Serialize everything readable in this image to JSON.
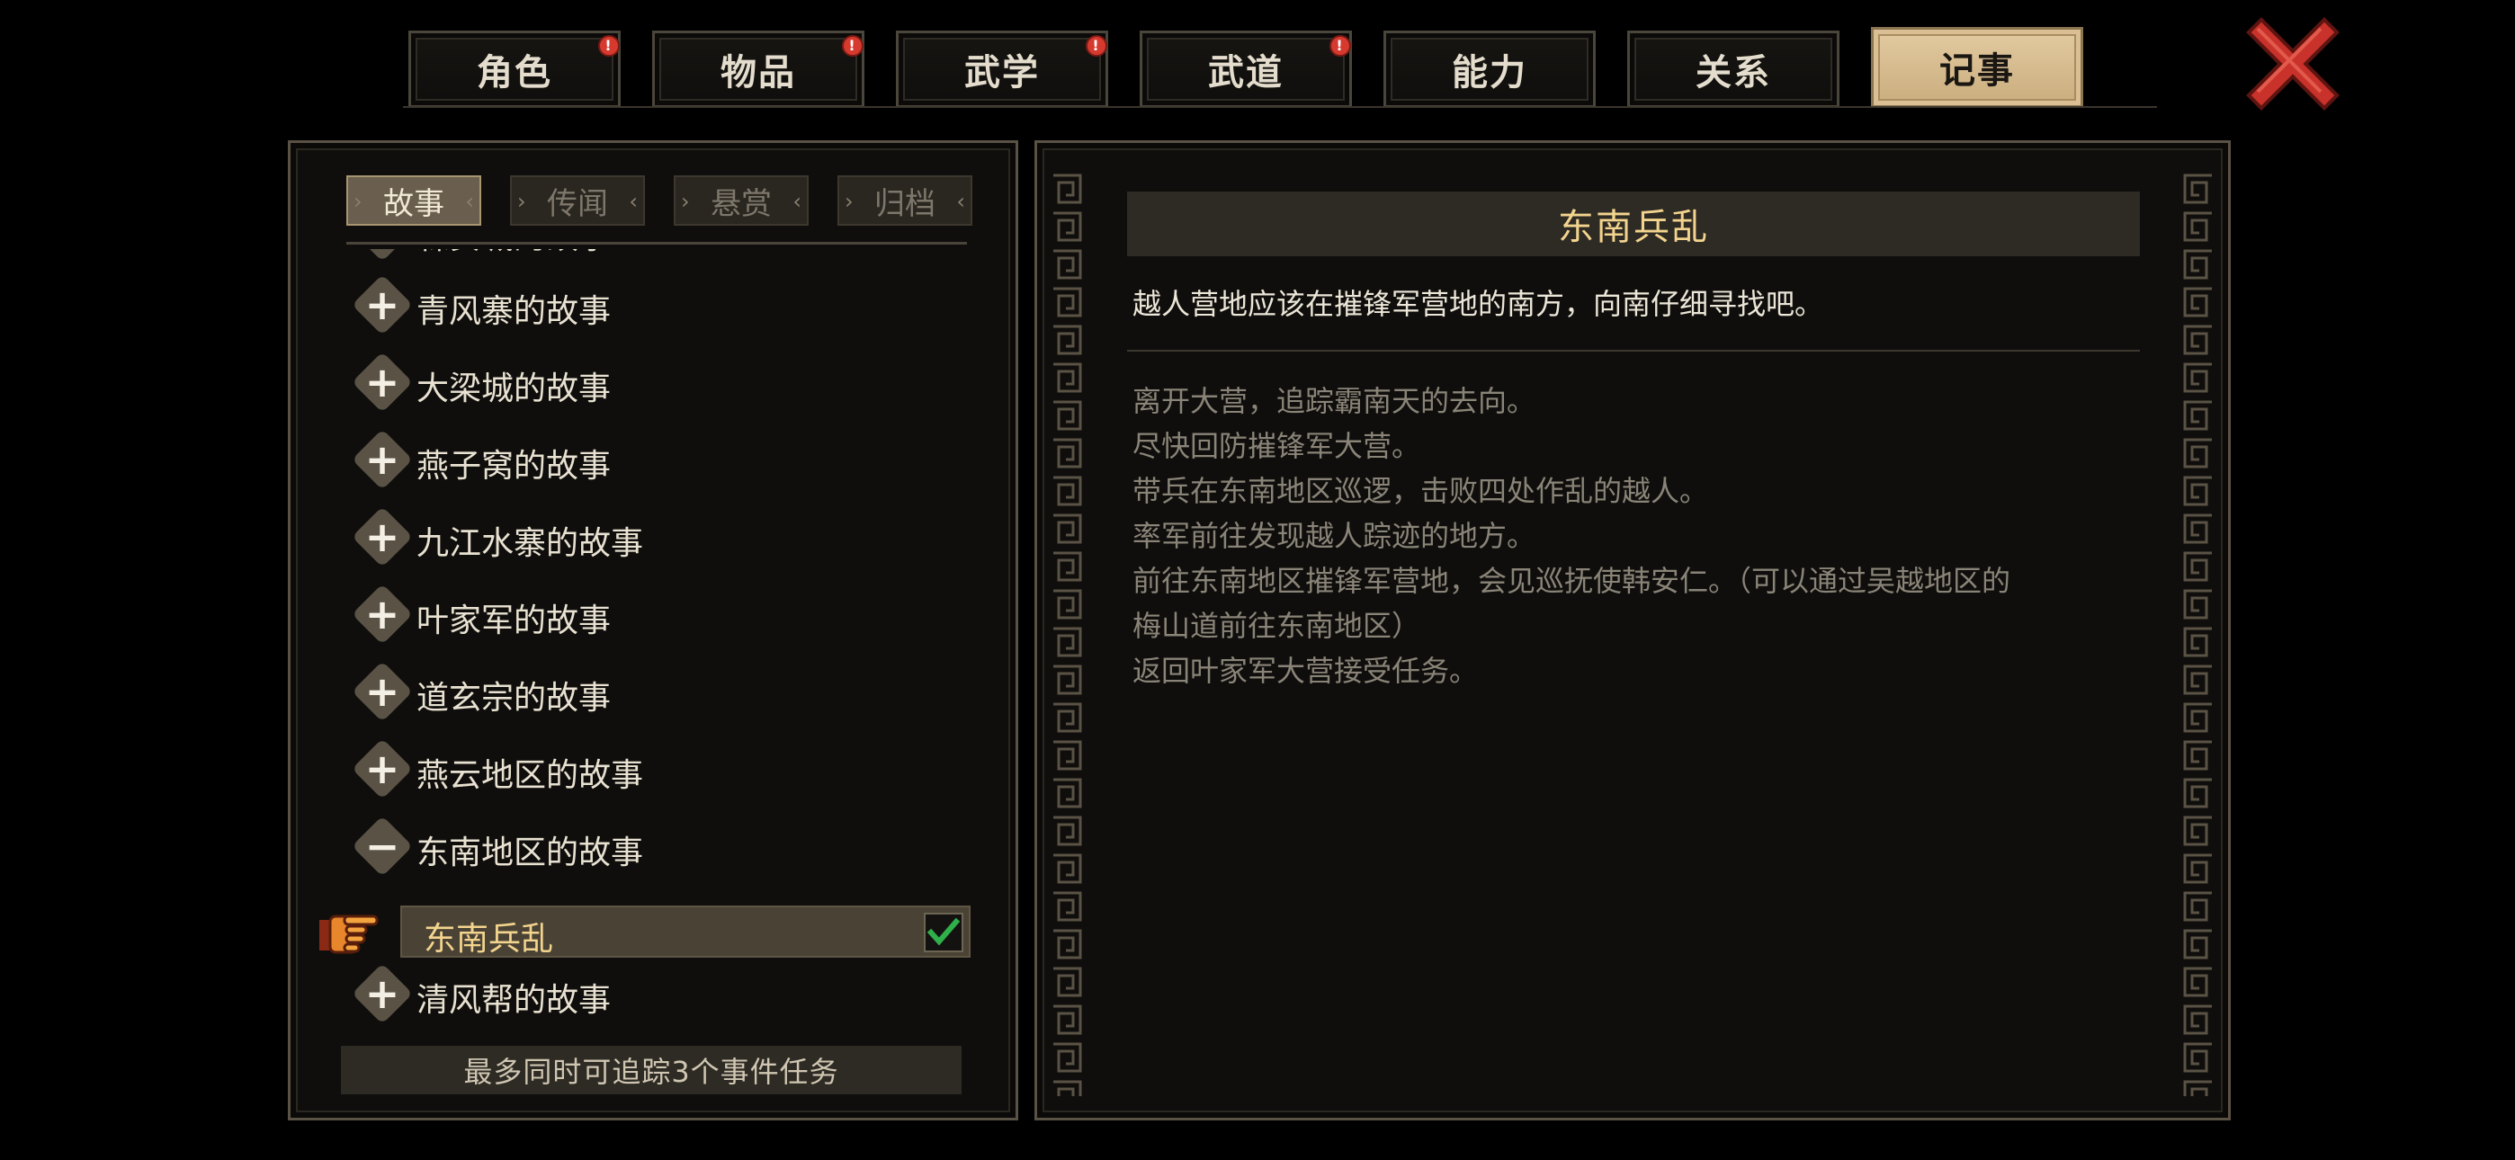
{
  "tabs": [
    {
      "label": "角色",
      "badge": "!"
    },
    {
      "label": "物品",
      "badge": "!"
    },
    {
      "label": "武学",
      "badge": "!"
    },
    {
      "label": "武道",
      "badge": "!"
    },
    {
      "label": "能力",
      "badge": ""
    },
    {
      "label": "关系",
      "badge": ""
    },
    {
      "label": "记事",
      "badge": ""
    }
  ],
  "active_tab": "记事",
  "subtabs": [
    "故事",
    "传闻",
    "悬赏",
    "归档"
  ],
  "active_subtab": "故事",
  "story_list": [
    {
      "label": "森安城的故事",
      "state": "collapsed"
    },
    {
      "label": "青风寨的故事",
      "state": "collapsed"
    },
    {
      "label": "大梁城的故事",
      "state": "collapsed"
    },
    {
      "label": "燕子窝的故事",
      "state": "collapsed"
    },
    {
      "label": "九江水寨的故事",
      "state": "collapsed"
    },
    {
      "label": "叶家军的故事",
      "state": "collapsed"
    },
    {
      "label": "道玄宗的故事",
      "state": "collapsed"
    },
    {
      "label": "燕云地区的故事",
      "state": "collapsed"
    },
    {
      "label": "东南地区的故事",
      "state": "expanded"
    },
    {
      "label": "清风帮的故事",
      "state": "collapsed"
    }
  ],
  "selected_quest": {
    "label": "东南兵乱",
    "tracked": true
  },
  "footer_hint": "最多同时可追踪3个事件任务",
  "detail": {
    "title": "东南兵乱",
    "current_objective": "越人营地应该在摧锋军营地的南方，向南仔细寻找吧。",
    "history": [
      "离开大营，追踪霸南天的去向。",
      "尽快回防摧锋军大营。",
      "带兵在东南地区巡逻，击败四处作乱的越人。",
      "率军前往发现越人踪迹的地方。",
      "前往东南地区摧锋军营地，会见巡抚使韩安仁。（可以通过吴越地区的\n梅山道前往东南地区）",
      "返回叶家军大营接受任务。"
    ]
  },
  "colors": {
    "accent_gold": "#f3d48e",
    "badge_red": "#d63a2f",
    "close_red": "#c8322a",
    "check_green": "#2fb04a"
  },
  "icons": {
    "close": "close-x-icon",
    "expand": "plus-icon",
    "collapse": "minus-icon",
    "pointer": "pointing-hand-icon",
    "check": "checkmark-icon"
  }
}
